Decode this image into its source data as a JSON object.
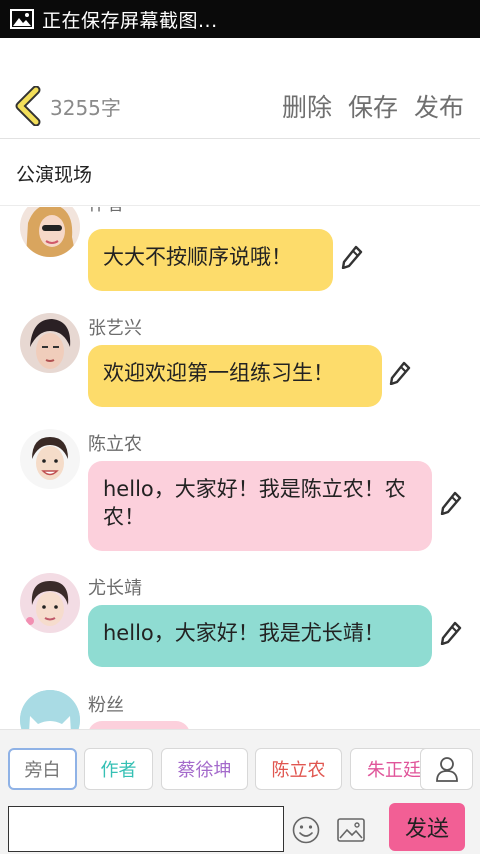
{
  "status_bar": {
    "text": "正在保存屏幕截图..."
  },
  "header": {
    "word_count": "3255字",
    "actions": {
      "delete": "删除",
      "save": "保存",
      "publish": "发布"
    }
  },
  "title_bar": {
    "title": "公演现场"
  },
  "messages": [
    {
      "speaker": "作者",
      "text": "大大不按顺序说哦！",
      "bubble_color": "#fddc6b"
    },
    {
      "speaker": "张艺兴",
      "text": "欢迎欢迎第一组练习生！",
      "bubble_color": "#fddc6b"
    },
    {
      "speaker": "陈立农",
      "text": "hello，大家好！我是陈立农！农农！",
      "bubble_color": "#fcd0dc"
    },
    {
      "speaker": "尤长靖",
      "text": "hello，大家好！我是尤长靖！",
      "bubble_color": "#8fdcd2"
    },
    {
      "speaker": "粉丝",
      "text": "",
      "bubble_color": "#fcd0dc"
    }
  ],
  "role_tabs": [
    {
      "label": "旁白",
      "color": "#777777"
    },
    {
      "label": "作者",
      "color": "#35c0b4"
    },
    {
      "label": "蔡徐坤",
      "color": "#a46acb"
    },
    {
      "label": "陈立农",
      "color": "#e0554f"
    },
    {
      "label": "朱正廷",
      "color": "#e0559a"
    }
  ],
  "composer": {
    "input_value": "",
    "input_placeholder": "",
    "send_label": "发送"
  },
  "colors": {
    "accent": "#f25f95",
    "icon_yellow": "#f3df5a"
  }
}
